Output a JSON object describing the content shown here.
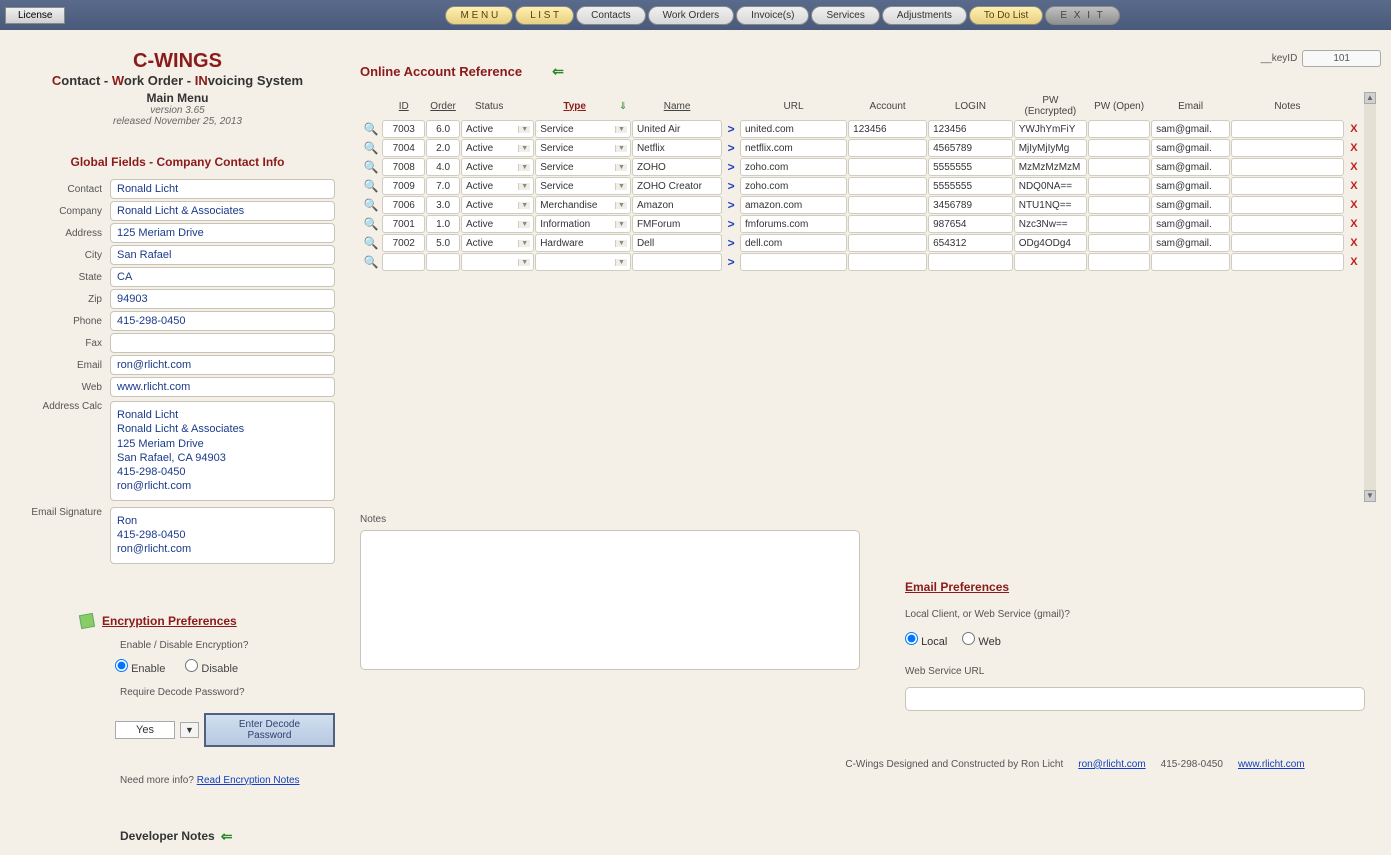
{
  "toolbar": {
    "license": "License",
    "menu": "M E N U",
    "list": "L I S T",
    "contacts": "Contacts",
    "work_orders": "Work Orders",
    "invoices": "Invoice(s)",
    "services": "Services",
    "adjustments": "Adjustments",
    "todo": "To Do List",
    "exit": "E X I T"
  },
  "keyid": {
    "label": "__keyID",
    "value": "101"
  },
  "brand": {
    "title": "C-WINGS",
    "subtitle_parts": [
      "C",
      "ontact - ",
      "W",
      "ork Order - ",
      "IN",
      "voicing System"
    ],
    "main_menu": "Main Menu",
    "version": "version 3.65",
    "released": "released  November 25, 2013"
  },
  "company_heading": "Global Fields - Company Contact Info",
  "labels": {
    "contact": "Contact",
    "company": "Company",
    "address": "Address",
    "city": "City",
    "state": "State",
    "zip": "Zip",
    "phone": "Phone",
    "fax": "Fax",
    "email": "Email",
    "web": "Web",
    "address_calc": "Address Calc",
    "email_sig": "Email Signature"
  },
  "contact": {
    "contact": "Ronald Licht",
    "company": "Ronald Licht & Associates",
    "address": "125 Meriam Drive",
    "city": "San Rafael",
    "state": "CA",
    "zip": "94903",
    "phone": "415-298-0450",
    "fax": "",
    "email": "ron@rlicht.com",
    "web": "www.rlicht.com",
    "address_calc": "Ronald Licht\nRonald Licht & Associates\n125 Meriam Drive\nSan Rafael, CA  94903\n415-298-0450\nron@rlicht.com",
    "email_sig": "Ron\n415-298-0450\nron@rlicht.com"
  },
  "encryption": {
    "heading": "Encryption Preferences",
    "enable_q": "Enable / Disable Encryption?",
    "enable": "Enable",
    "disable": "Disable",
    "require_q": "Require Decode Password?",
    "require_value": "Yes",
    "decode_btn": "Enter Decode Password",
    "more_info": "Need more info?  ",
    "read_notes": "Read Encryption Notes"
  },
  "dev_notes": "Developer Notes",
  "ref_heading": "Online Account Reference",
  "columns": {
    "id": "ID",
    "order": "Order",
    "status": "Status",
    "type": "Type",
    "name": "Name",
    "url": "URL",
    "account": "Account",
    "login": "LOGIN",
    "pw_enc": "PW (Encrypted)",
    "pw_open": "PW (Open)",
    "email": "Email",
    "notes": "Notes"
  },
  "rows": [
    {
      "id": "7003",
      "order": "6.0",
      "status": "Active",
      "type": "Service",
      "name": "United Air",
      "url": "united.com",
      "account": "123456",
      "login": "123456",
      "pw_enc": "YWJhYmFiY",
      "pw_open": "",
      "email": "sam@gmail.",
      "notes": ""
    },
    {
      "id": "7004",
      "order": "2.0",
      "status": "Active",
      "type": "Service",
      "name": "Netflix",
      "url": "netflix.com",
      "account": "",
      "login": "4565789",
      "pw_enc": "MjIyMjIyMg",
      "pw_open": "",
      "email": "sam@gmail.",
      "notes": ""
    },
    {
      "id": "7008",
      "order": "4.0",
      "status": "Active",
      "type": "Service",
      "name": "ZOHO",
      "url": "zoho.com",
      "account": "",
      "login": "5555555",
      "pw_enc": "MzMzMzMzM",
      "pw_open": "",
      "email": "sam@gmail.",
      "notes": ""
    },
    {
      "id": "7009",
      "order": "7.0",
      "status": "Active",
      "type": "Service",
      "name": "ZOHO Creator",
      "url": "zoho.com",
      "account": "",
      "login": "5555555",
      "pw_enc": "NDQ0NA==",
      "pw_open": "",
      "email": "sam@gmail.",
      "notes": ""
    },
    {
      "id": "7006",
      "order": "3.0",
      "status": "Active",
      "type": "Merchandise",
      "name": "Amazon",
      "url": "amazon.com",
      "account": "",
      "login": "3456789",
      "pw_enc": "NTU1NQ==",
      "pw_open": "",
      "email": "sam@gmail.",
      "notes": ""
    },
    {
      "id": "7001",
      "order": "1.0",
      "status": "Active",
      "type": "Information",
      "name": "FMForum",
      "url": "fmforums.com",
      "account": "",
      "login": "987654",
      "pw_enc": "Nzc3Nw==",
      "pw_open": "",
      "email": "sam@gmail.",
      "notes": ""
    },
    {
      "id": "7002",
      "order": "5.0",
      "status": "Active",
      "type": "Hardware",
      "name": "Dell",
      "url": "dell.com",
      "account": "",
      "login": "654312",
      "pw_enc": "ODg4ODg4",
      "pw_open": "",
      "email": "sam@gmail.",
      "notes": ""
    },
    {
      "id": "",
      "order": "",
      "status": "",
      "type": "",
      "name": "",
      "url": "",
      "account": "",
      "login": "",
      "pw_enc": "",
      "pw_open": "",
      "email": "",
      "notes": ""
    }
  ],
  "notes_label": "Notes",
  "email_prefs": {
    "heading": "Email Preferences",
    "q": "Local Client, or Web Service (gmail)?",
    "local": "Local",
    "web": "Web",
    "web_url_label": "Web Service URL"
  },
  "footer": {
    "designed": "C-Wings Designed and Constructed by Ron Licht",
    "email": " ron@rlicht.com",
    "phone": "415-298-0450",
    "url": "www.rlicht.com"
  }
}
